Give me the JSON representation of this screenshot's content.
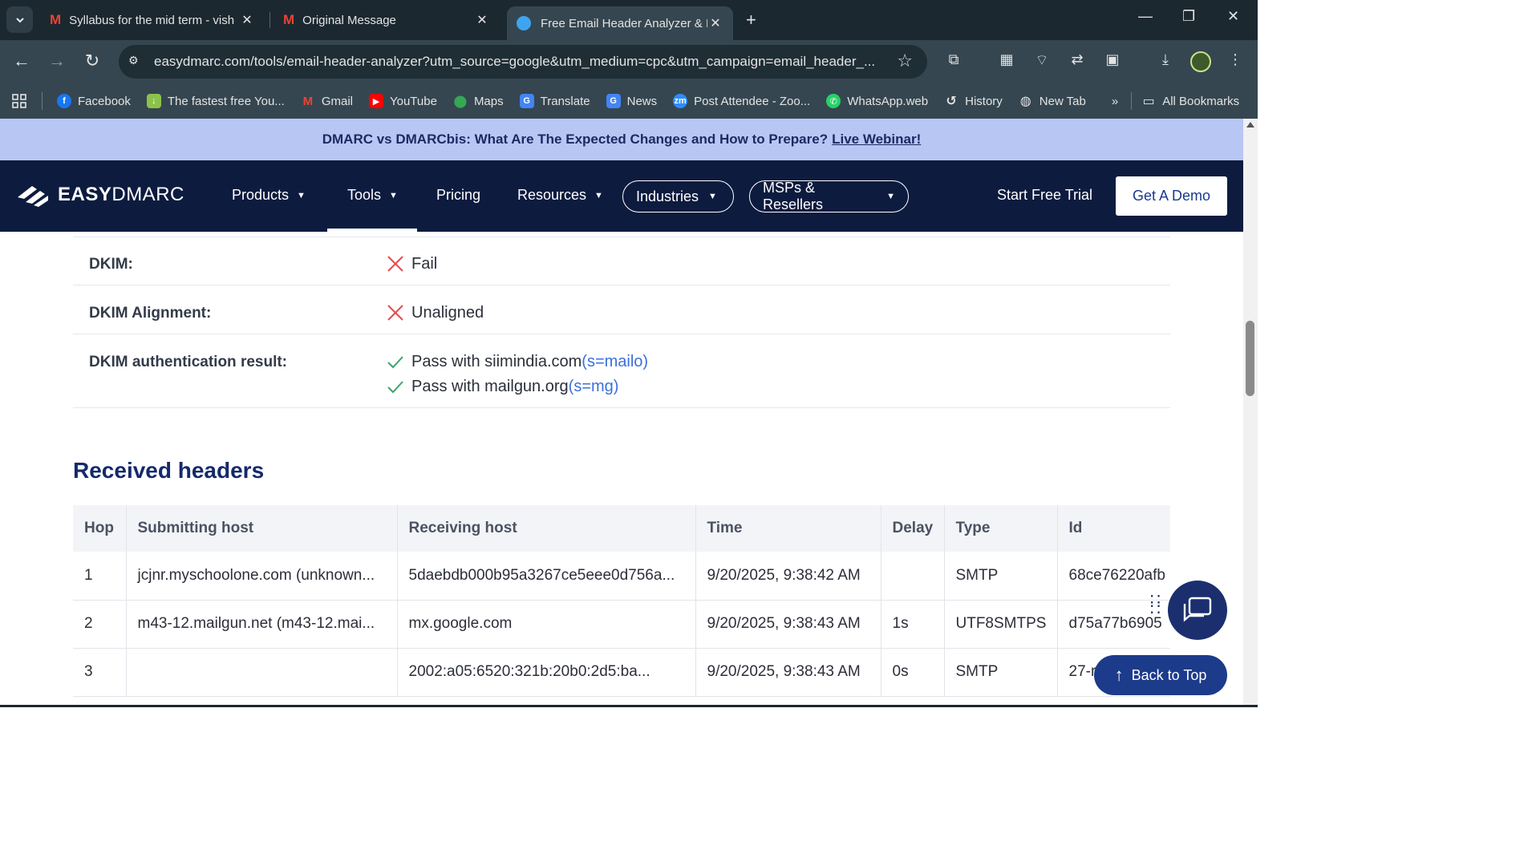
{
  "browser": {
    "tabs": [
      {
        "title": "Syllabus for the mid term - vish",
        "close": "✕"
      },
      {
        "title": "Original Message",
        "close": "✕"
      },
      {
        "title": "Free Email Header Analyzer & In",
        "close": "✕"
      }
    ],
    "new_tab": "+",
    "url": "easydmarc.com/tools/email-header-analyzer?utm_source=google&utm_medium=cpc&utm_campaign=email_header_...",
    "bookmarks": [
      {
        "label": "Facebook",
        "icon": "facebook-icon",
        "color": "#1877f2"
      },
      {
        "label": "The fastest free You...",
        "icon": "download-arrow-icon",
        "color": "#8bc34a"
      },
      {
        "label": "Gmail",
        "icon": "gmail-icon",
        "color": "#ea4335"
      },
      {
        "label": "YouTube",
        "icon": "youtube-icon",
        "color": "#ff0000"
      },
      {
        "label": "Maps",
        "icon": "maps-icon",
        "color": "#34a853"
      },
      {
        "label": "Translate",
        "icon": "translate-icon",
        "color": "#4285f4"
      },
      {
        "label": "News",
        "icon": "news-icon",
        "color": "#4285f4"
      },
      {
        "label": "Post Attendee - Zoo...",
        "icon": "zoom-icon",
        "color": "#2d8cff"
      },
      {
        "label": "WhatsApp.web",
        "icon": "whatsapp-icon",
        "color": "#25d366"
      },
      {
        "label": "History",
        "icon": "history-icon",
        "color": "#e3e3e3"
      },
      {
        "label": "New Tab",
        "icon": "globe-icon",
        "color": "#e3e3e3"
      }
    ],
    "overflow": "»",
    "all_bookmarks": "All Bookmarks"
  },
  "banner": {
    "text": "DMARC vs DMARCbis: What Are The Expected Changes and How to Prepare?",
    "link": "Live Webinar!"
  },
  "nav": {
    "logo_bold": "EASY",
    "logo_light": "DMARC",
    "items": [
      "Products",
      "Tools",
      "Pricing",
      "Resources"
    ],
    "pills": [
      "Industries",
      "MSPs & Resellers"
    ],
    "start_trial": "Start Free Trial",
    "demo": "Get A Demo"
  },
  "auth": {
    "dkim_label": "DKIM:",
    "dkim_value": "Fail",
    "align_label": "DKIM Alignment:",
    "align_value": "Unaligned",
    "result_label": "DKIM authentication result:",
    "results": [
      {
        "text": "Pass with siimindia.com",
        "selector": "(s=mailo)"
      },
      {
        "text": "Pass with mailgun.org",
        "selector": "(s=mg)"
      }
    ]
  },
  "received": {
    "title": "Received headers",
    "columns": [
      "Hop",
      "Submitting host",
      "Receiving host",
      "Time",
      "Delay",
      "Type",
      "Id"
    ],
    "rows": [
      [
        "1",
        "jcjnr.myschoolone.com (unknown...",
        "5daebdb000b95a3267ce5eee0d756a...",
        "9/20/2025, 9:38:42 AM",
        "",
        "SMTP",
        "68ce76220afb"
      ],
      [
        "2",
        "m43-12.mailgun.net (m43-12.mai...",
        "mx.google.com",
        "9/20/2025, 9:38:43 AM",
        "1s",
        "UTF8SMTPS",
        "d75a77b6905"
      ],
      [
        "3",
        "",
        "2002:a05:6520:321b:20b0:2d5:ba...",
        "9/20/2025, 9:38:43 AM",
        "0s",
        "SMTP",
        "27-r"
      ]
    ]
  },
  "back_to_top": "Back to Top"
}
